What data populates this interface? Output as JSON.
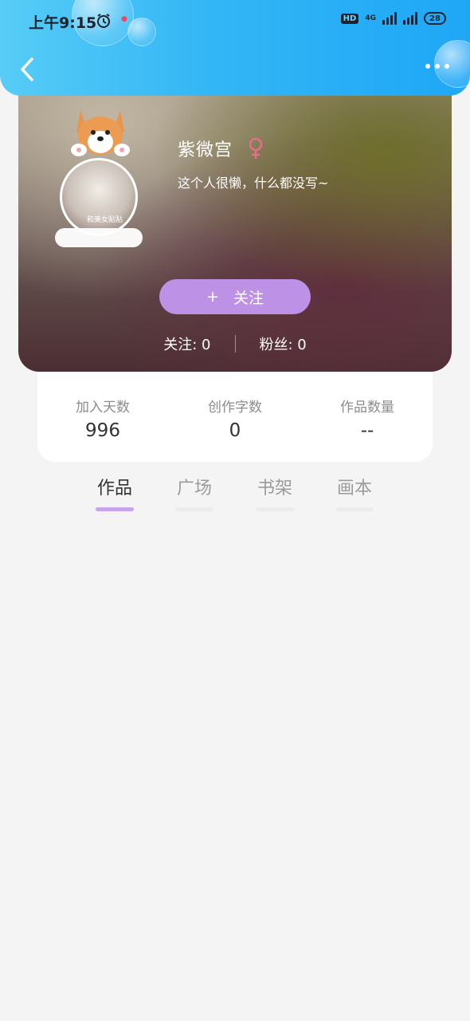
{
  "status_bar": {
    "time": "上午9:15",
    "hd": "HD",
    "network": "4G",
    "battery": "28"
  },
  "profile": {
    "name": "紫微宫",
    "bio": "这个人很懒，什么都没写~",
    "avatar_tag": "和美女贴贴",
    "follow_plus": "+",
    "follow_label": "关注",
    "following": "关注: 0",
    "followers": "粉丝: 0"
  },
  "stats": [
    {
      "label": "加入天数",
      "value": "996"
    },
    {
      "label": "创作字数",
      "value": "0"
    },
    {
      "label": "作品数量",
      "value": "--"
    }
  ],
  "tabs": [
    {
      "label": "作品",
      "active": true
    },
    {
      "label": "广场",
      "active": false
    },
    {
      "label": "书架",
      "active": false
    },
    {
      "label": "画本",
      "active": false
    }
  ],
  "colors": {
    "accent": "#bc91e6",
    "header": "#33b6f5",
    "tab_active_underline": "#c8a4ec"
  }
}
